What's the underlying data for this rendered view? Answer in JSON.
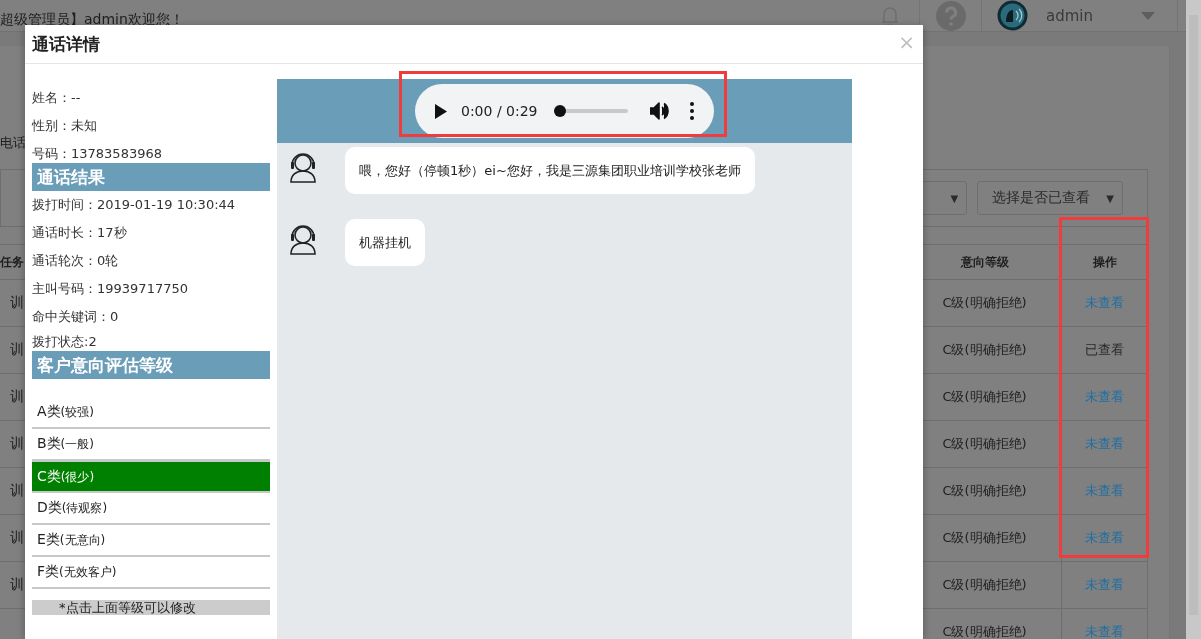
{
  "background": {
    "greeting": "超级管理员】admin欢迎您！",
    "username": "admin",
    "card_title": "电话",
    "selects": [
      {
        "arrow": "▼"
      },
      {
        "label": "选择是否已查看",
        "arrow": "▼"
      }
    ]
  },
  "table": {
    "columns": [
      "任务",
      "意向等级",
      "操作"
    ],
    "action_column_highlighted": true,
    "rows": [
      {
        "task": "训",
        "level": "C级(明确拒绝)",
        "action": "未查看",
        "viewed": false
      },
      {
        "task": "训",
        "level": "C级(明确拒绝)",
        "action": "已查看",
        "viewed": true
      },
      {
        "task": "训",
        "level": "C级(明确拒绝)",
        "action": "未查看",
        "viewed": false
      },
      {
        "task": "训",
        "level": "C级(明确拒绝)",
        "action": "未查看",
        "viewed": false
      },
      {
        "task": "训",
        "level": "C级(明确拒绝)",
        "action": "未查看",
        "viewed": false
      },
      {
        "task": "训",
        "level": "C级(明确拒绝)",
        "action": "未查看",
        "viewed": false
      },
      {
        "task": "训",
        "level": "C级(明确拒绝)",
        "action": "未查看",
        "viewed": false
      },
      {
        "level": "C级(明确拒绝)",
        "action": "未查看",
        "viewed": false
      }
    ]
  },
  "modal": {
    "title": "通话详情",
    "close": "×",
    "info": [
      "姓名：--",
      "性别：未知",
      "号码：13783583968"
    ],
    "result_title": "通话结果",
    "result": [
      "拨打时间：2019-01-19 10:30:44",
      "通话时长：17秒",
      "通话轮次：0轮",
      "主叫号码：19939717750",
      "命中关键词：0"
    ],
    "status": "拨打状态:2",
    "grade_title": "客户意向评估等级",
    "grades": [
      {
        "letter": "A类",
        "desc": "(较强)",
        "selected": false
      },
      {
        "letter": "B类",
        "desc": "(一般)",
        "selected": false
      },
      {
        "letter": "C类",
        "desc": "(很少)",
        "selected": true
      },
      {
        "letter": "D类",
        "desc": "(待观察)",
        "selected": false
      },
      {
        "letter": "E类",
        "desc": "(无意向)",
        "selected": false
      },
      {
        "letter": "F类",
        "desc": "(无效客户)",
        "selected": false
      }
    ],
    "hint": "*点击上面等级可以修改",
    "audio": {
      "time": "0:00 / 0:29",
      "level": 0,
      "highlighted": true
    },
    "messages": [
      {
        "text": "喂，您好（停顿1秒）ei~您好，我是三源集团职业培训学校张老师"
      },
      {
        "text": "机器挂机"
      }
    ]
  }
}
